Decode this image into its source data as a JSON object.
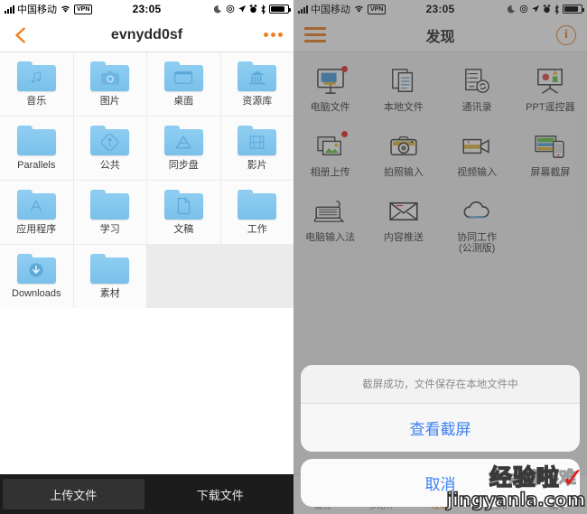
{
  "status_bar": {
    "carrier": "中国移动",
    "vpn_label": "VPN",
    "time": "23:05",
    "icons": [
      "moon-icon",
      "do-not-disturb-icon",
      "location-arrow-icon",
      "alarm-icon",
      "bluetooth-icon",
      "battery-icon"
    ]
  },
  "left_screen": {
    "nav": {
      "back_icon": "back-chevron-icon",
      "title": "evnydd0sf",
      "more_icon": "more-dots-icon"
    },
    "folders": [
      {
        "label": "音乐",
        "glyph": "♪",
        "icon": "music-note-icon"
      },
      {
        "label": "图片",
        "glyph": "◉",
        "icon": "camera-icon"
      },
      {
        "label": "桌面",
        "glyph": "▭",
        "icon": "desktop-window-icon"
      },
      {
        "label": "资源库",
        "glyph": "🏛",
        "icon": "library-icon"
      },
      {
        "label": "Parallels",
        "glyph": "",
        "icon": "plain-folder-icon"
      },
      {
        "label": "公共",
        "glyph": "◈",
        "icon": "public-folder-icon"
      },
      {
        "label": "同步盘",
        "glyph": "▲",
        "icon": "drive-icon"
      },
      {
        "label": "影片",
        "glyph": "▤",
        "icon": "film-icon"
      },
      {
        "label": "应用程序",
        "glyph": "A",
        "icon": "applications-icon"
      },
      {
        "label": "学习",
        "glyph": "",
        "icon": "plain-folder-icon"
      },
      {
        "label": "文稿",
        "glyph": "📄",
        "icon": "document-icon"
      },
      {
        "label": "工作",
        "glyph": "",
        "icon": "plain-folder-icon"
      },
      {
        "label": "Downloads",
        "glyph": "↓",
        "icon": "download-icon"
      },
      {
        "label": "素材",
        "glyph": "",
        "icon": "plain-folder-icon"
      }
    ],
    "bottom_buttons": [
      {
        "label": "上传文件",
        "active": true
      },
      {
        "label": "下载文件",
        "active": false
      }
    ]
  },
  "right_screen": {
    "nav": {
      "menu_icon": "hamburger-menu-icon",
      "title": "发现",
      "info_icon": "info-circle-icon"
    },
    "discover_items": [
      {
        "label": "电脑文件",
        "icon": "computer-monitor-icon",
        "badge": true
      },
      {
        "label": "本地文件",
        "icon": "documents-stack-icon",
        "badge": false
      },
      {
        "label": "通讯录",
        "icon": "contacts-sync-icon",
        "badge": false
      },
      {
        "label": "PPT遥控器",
        "icon": "presentation-icon",
        "badge": false
      },
      {
        "label": "相册上传",
        "icon": "photo-album-icon",
        "badge": true
      },
      {
        "label": "拍照输入",
        "icon": "camera-input-icon",
        "badge": false
      },
      {
        "label": "视频输入",
        "icon": "video-camera-icon",
        "badge": false
      },
      {
        "label": "屏幕截屏",
        "icon": "screen-capture-icon",
        "badge": false
      },
      {
        "label": "电脑输入法",
        "icon": "keyboard-icon",
        "badge": false
      },
      {
        "label": "内容推送",
        "icon": "envelope-icon",
        "badge": false
      },
      {
        "label": "协同工作\n(公测版)",
        "icon": "cloud-icon",
        "badge": false
      }
    ],
    "action_sheet": {
      "message": "截屏成功，文件保存在本地文件中",
      "primary_action": "查看截屏",
      "cancel_action": "取消"
    },
    "tabs": [
      {
        "label": "遥控",
        "active": false
      },
      {
        "label": "多陪伴",
        "active": false
      },
      {
        "label": "发现",
        "active": true
      },
      {
        "label": "应用",
        "active": false
      },
      {
        "label": "指令",
        "active": false
      }
    ]
  },
  "watermark": {
    "brand": "经验啦",
    "check": "✓",
    "url": "jingyanla.com",
    "sub": "一点都不难"
  },
  "colors": {
    "accent_orange": "#f08020",
    "folder_blue": "#81c5ef",
    "link_blue": "#3d81f0",
    "badge_red": "#ee2b2b",
    "dark_bar": "#1c1c1c"
  }
}
